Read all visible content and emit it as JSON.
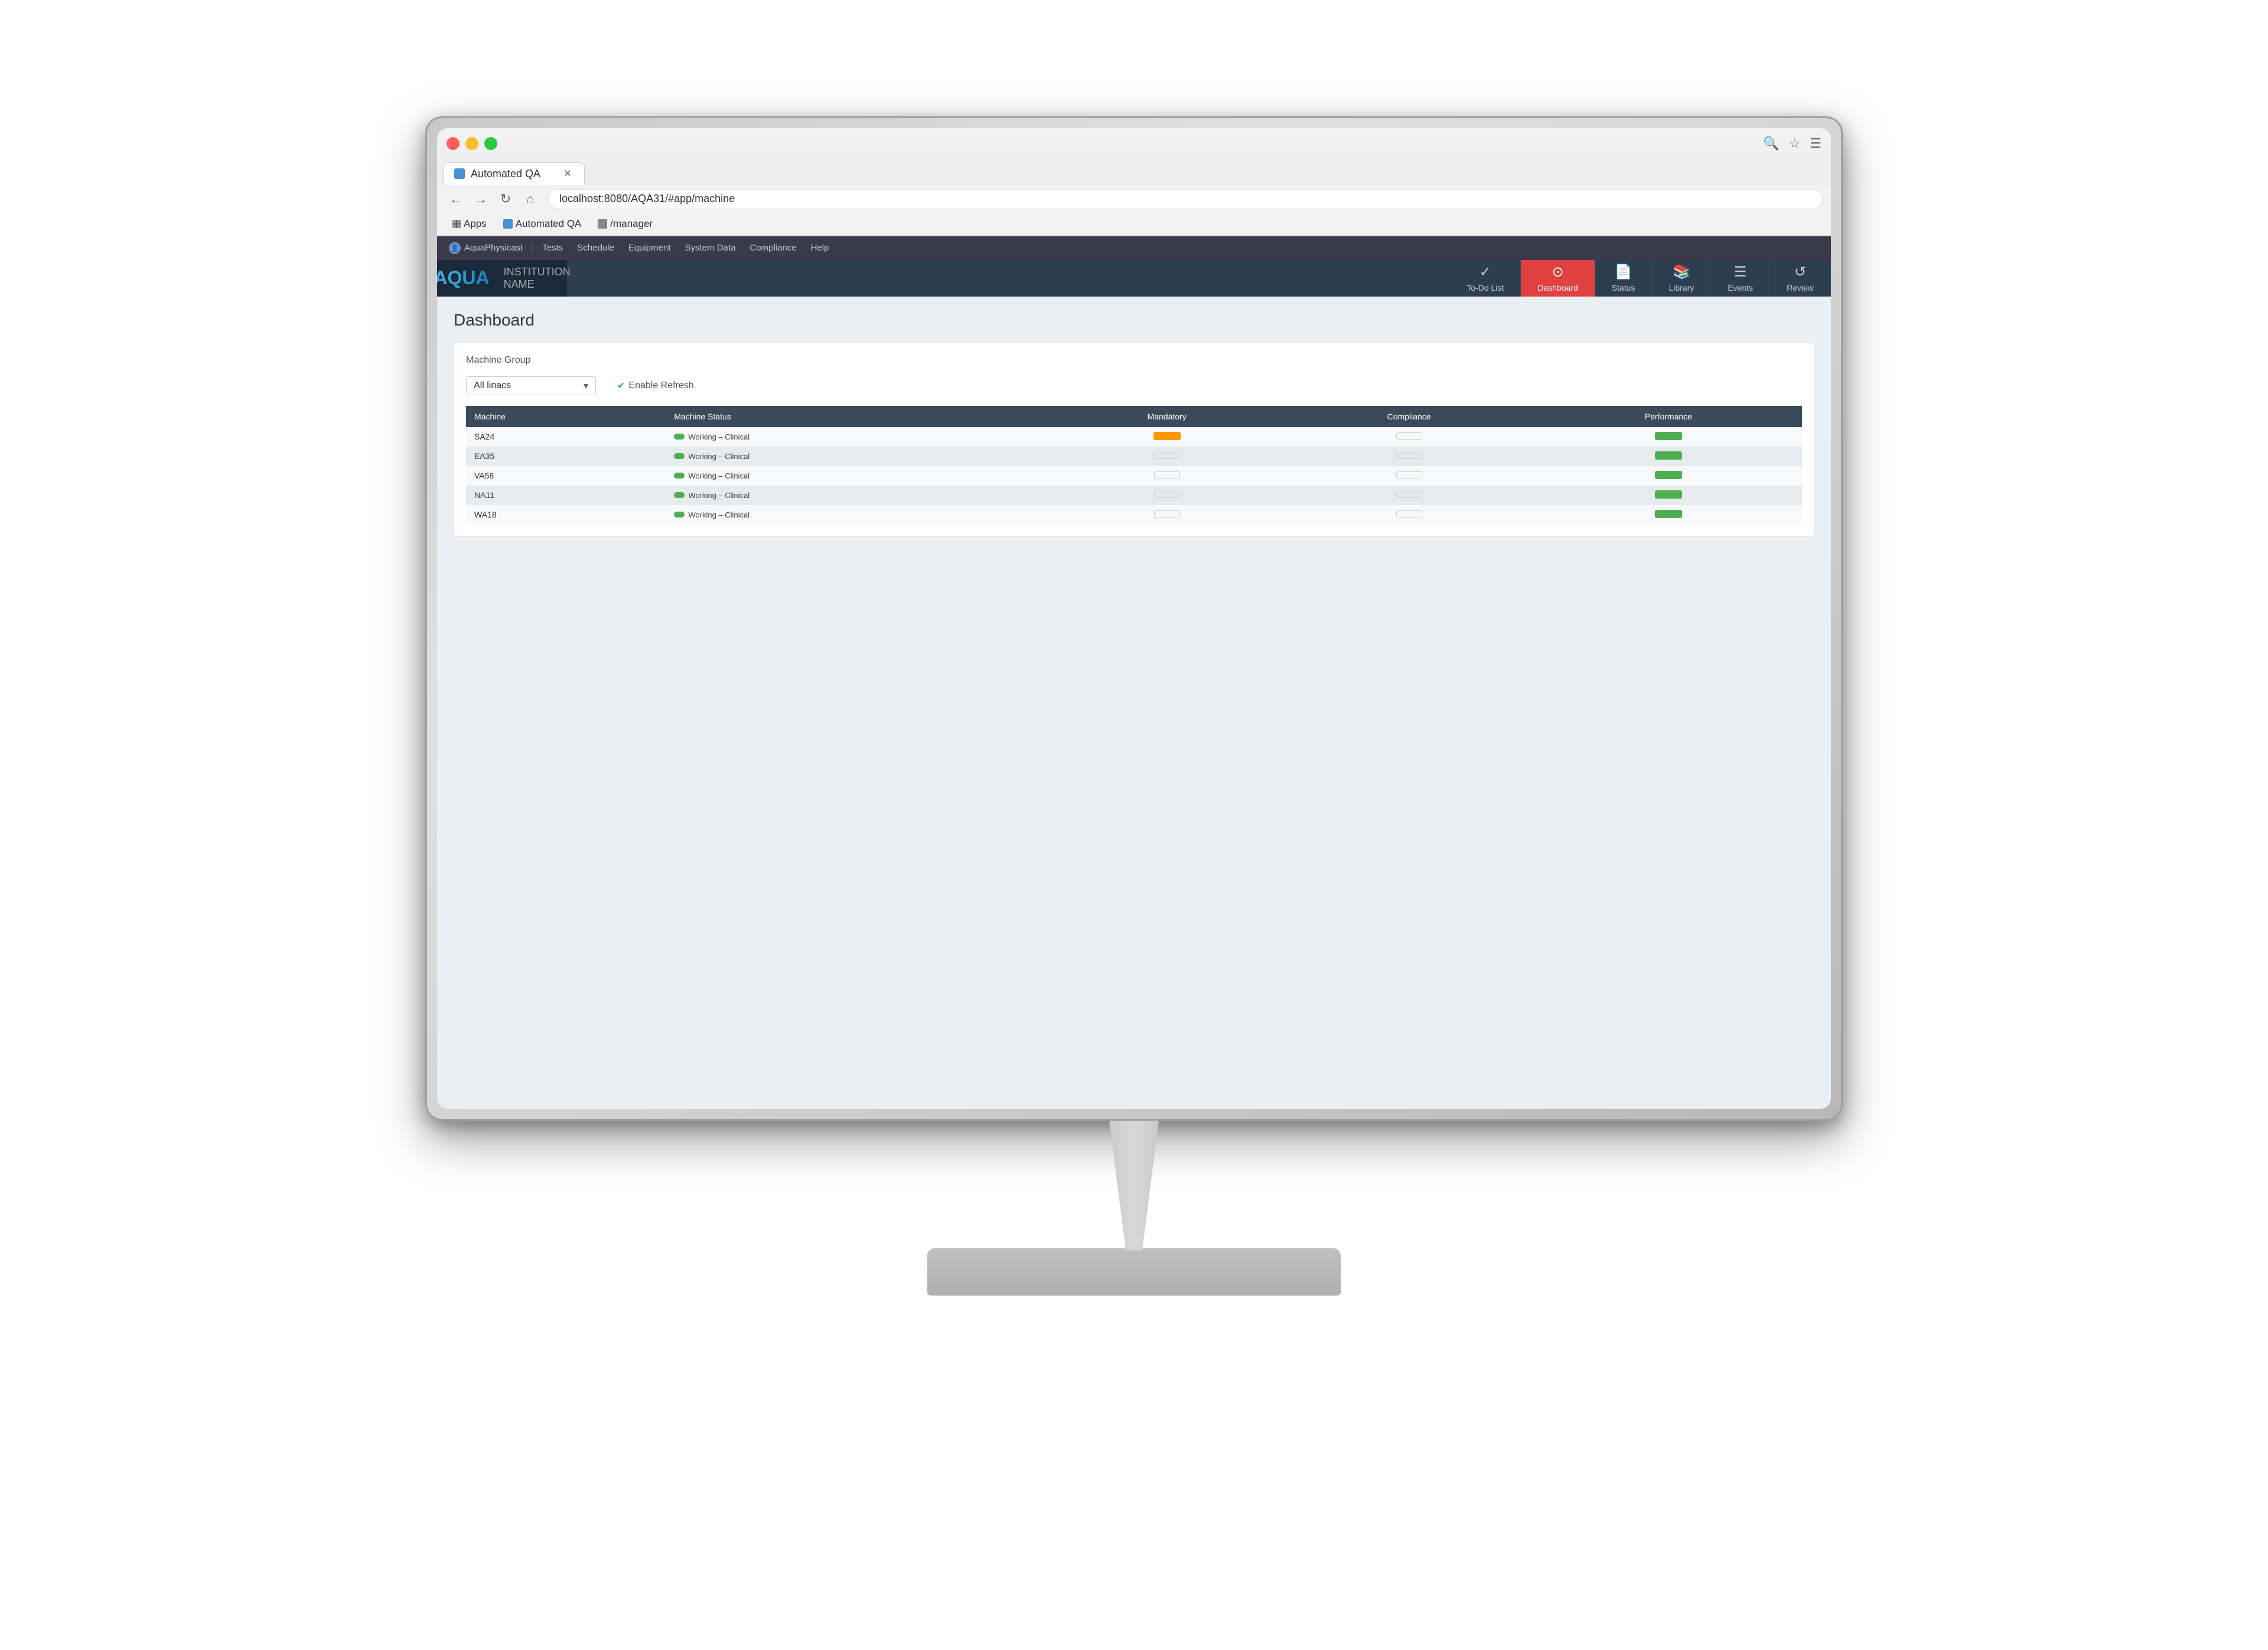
{
  "monitor": {
    "institution": "INSTITUTION NAME"
  },
  "browser": {
    "tab_title": "Automated QA",
    "url": "localhost:8080/AQA31/#app/machine",
    "bookmarks": [
      {
        "label": "Apps",
        "icon": "grid"
      },
      {
        "label": "Automated QA",
        "icon": "aq"
      },
      {
        "label": "/manager",
        "icon": "folder"
      }
    ]
  },
  "app_nav": {
    "user": "AquaPhysicast",
    "items": [
      "Tests",
      "Schedule",
      "Equipment",
      "System Data",
      "Compliance",
      "Help"
    ]
  },
  "toolbar": {
    "logo": "AQUA",
    "institution": "INSTITUTION NAME",
    "nav_items": [
      {
        "label": "To-Do List",
        "icon": "✓",
        "active": false
      },
      {
        "label": "Dashboard",
        "icon": "⊙",
        "active": true
      },
      {
        "label": "Status",
        "icon": "📄",
        "active": false
      },
      {
        "label": "Library",
        "icon": "📚",
        "active": false
      },
      {
        "label": "Events",
        "icon": "☰",
        "active": false
      },
      {
        "label": "Review",
        "icon": "↺",
        "active": false
      }
    ]
  },
  "dashboard": {
    "title": "Dashboard",
    "filter_label": "Machine Group",
    "filter_value": "All linacs",
    "enable_refresh_label": "Enable Refresh",
    "table": {
      "headers": [
        "Machine",
        "Machine Status",
        "Mandatory",
        "Compliance",
        "Performance"
      ],
      "rows": [
        {
          "machine": "SA24",
          "status_dot": "green",
          "status_text": "Working – Clinical",
          "mandatory": "yellow",
          "compliance": "outline",
          "performance": "green"
        },
        {
          "machine": "EA35",
          "status_dot": "green",
          "status_text": "Working – Clinical",
          "mandatory": "outline",
          "compliance": "outline",
          "performance": "green"
        },
        {
          "machine": "VA58",
          "status_dot": "green",
          "status_text": "Working – Clinical",
          "mandatory": "outline",
          "compliance": "outline",
          "performance": "green"
        },
        {
          "machine": "NA11",
          "status_dot": "green",
          "status_text": "Working – Clinical",
          "mandatory": "outline",
          "compliance": "outline",
          "performance": "green"
        },
        {
          "machine": "WA18",
          "status_dot": "green",
          "status_text": "Working – Clinical",
          "mandatory": "outline",
          "compliance": "outline",
          "performance": "green"
        }
      ]
    }
  }
}
